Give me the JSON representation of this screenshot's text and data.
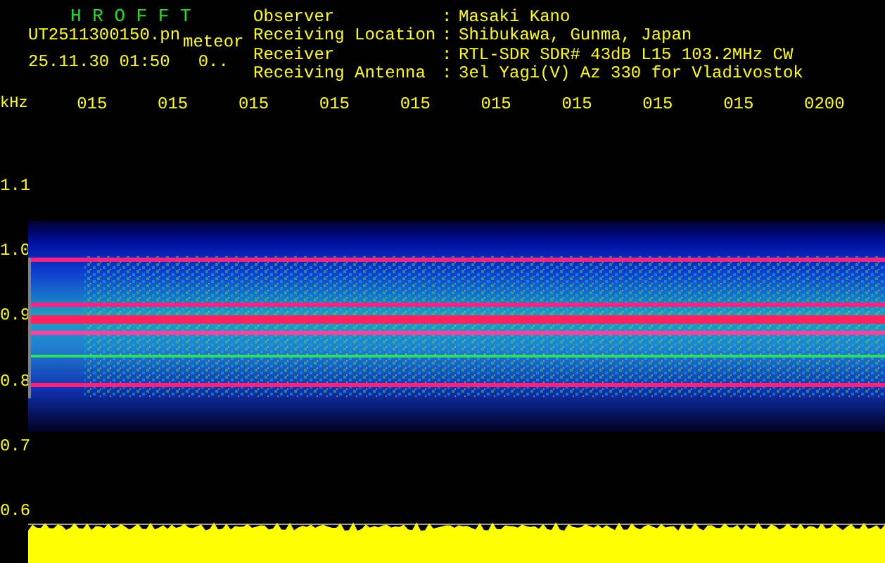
{
  "header": {
    "title": "H R O F F T",
    "filename": "UT2511300150.pn",
    "mode": "meteor",
    "timestamp": "25.11.30 01:50",
    "count": "0.."
  },
  "info": [
    {
      "label": "Observer",
      "separator": ":",
      "value": "Masaki Kano"
    },
    {
      "label": "Receiving Location",
      "separator": ":",
      "value": "Shibukawa, Gunma, Japan"
    },
    {
      "label": "Receiver",
      "separator": ":",
      "value": "RTL-SDR SDR# 43dB L15 103.2MHz CW"
    },
    {
      "label": "Receiving Antenna",
      "separator": ":",
      "value": "3el Yagi(V) Az 330 for Vladivostok"
    }
  ],
  "axis": {
    "unit": "kHz",
    "time_labels": [
      "015",
      "015",
      "015",
      "015",
      "015",
      "015",
      "015",
      "015",
      "015",
      "0200"
    ],
    "freq_labels": [
      "1.1",
      "1.0",
      "0.9",
      "0.8",
      "0.7",
      "0.6"
    ]
  }
}
